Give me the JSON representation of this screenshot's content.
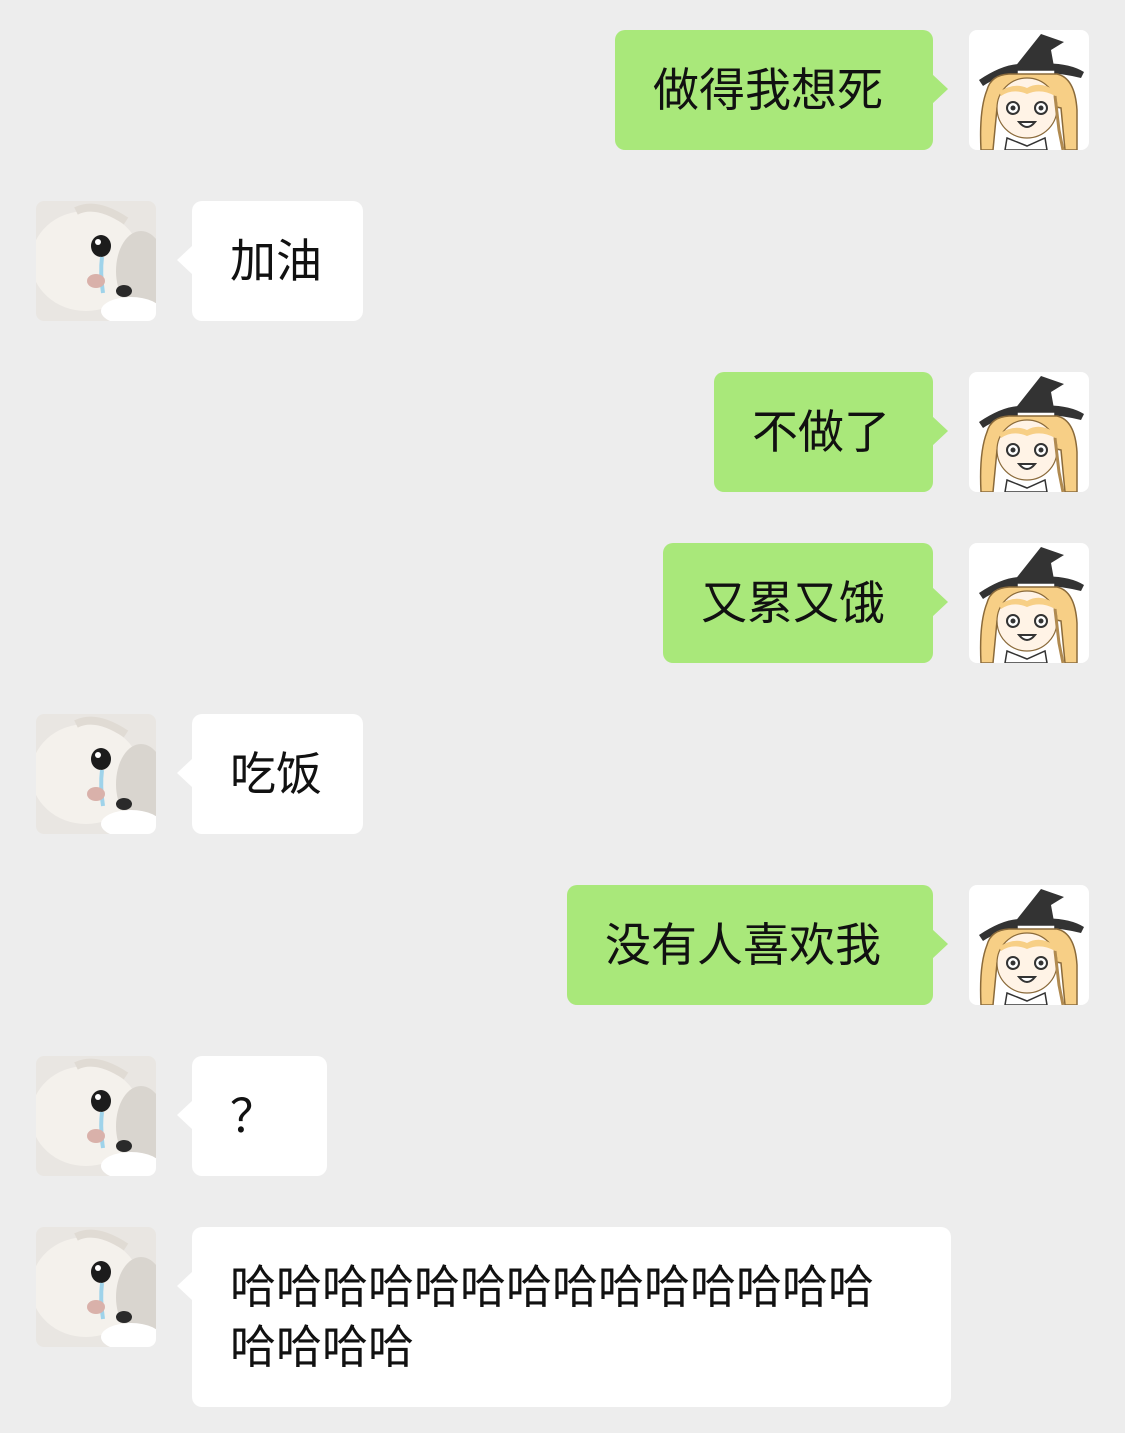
{
  "conversation": {
    "messages": [
      {
        "from": "me",
        "text": "做得我想死",
        "avatar_icon": "witch-girl-avatar-icon"
      },
      {
        "from": "them",
        "text": "加油",
        "avatar_icon": "crying-kitten-avatar-icon"
      },
      {
        "from": "me",
        "text": "不做了",
        "avatar_icon": "witch-girl-avatar-icon"
      },
      {
        "from": "me",
        "text": "又累又饿",
        "avatar_icon": "witch-girl-avatar-icon"
      },
      {
        "from": "them",
        "text": "吃饭",
        "avatar_icon": "crying-kitten-avatar-icon"
      },
      {
        "from": "me",
        "text": "没有人喜欢我",
        "avatar_icon": "witch-girl-avatar-icon"
      },
      {
        "from": "them",
        "text": "？",
        "avatar_icon": "crying-kitten-avatar-icon"
      },
      {
        "from": "them",
        "text": "哈哈哈哈哈哈哈哈哈哈哈哈哈哈哈哈哈哈",
        "avatar_icon": "crying-kitten-avatar-icon"
      }
    ]
  },
  "colors": {
    "background": "#ededed",
    "outgoing_bubble": "#a9e87a",
    "incoming_bubble": "#ffffff",
    "text": "#111111"
  }
}
